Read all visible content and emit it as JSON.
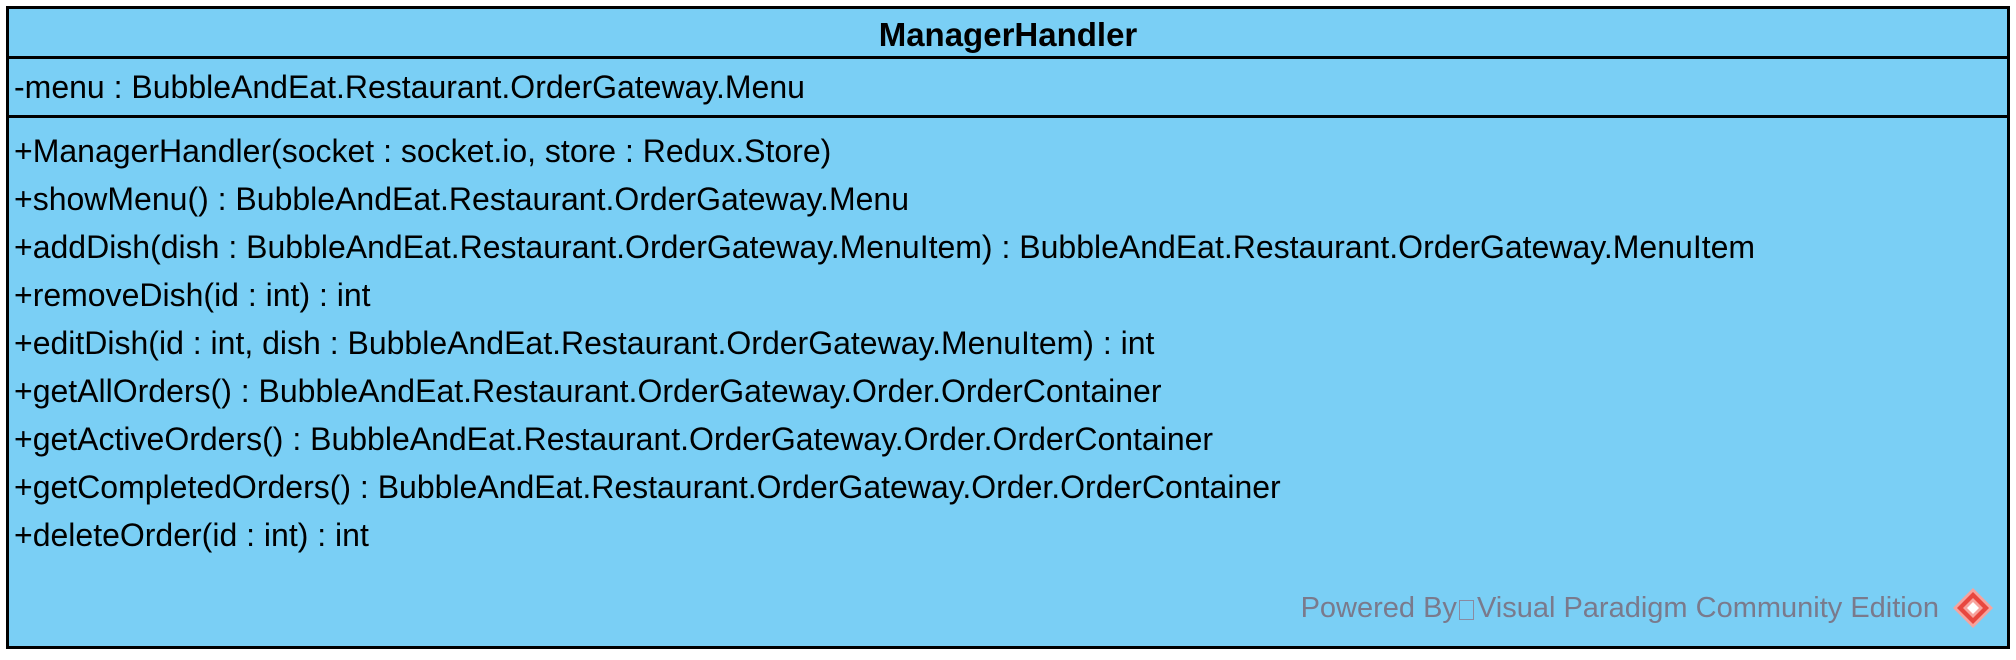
{
  "class": {
    "name": "ManagerHandler",
    "attributes": [
      "-menu : BubbleAndEat.Restaurant.OrderGateway.Menu"
    ],
    "operations": [
      "+ManagerHandler(socket : socket.io, store : Redux.Store)",
      "+showMenu() : BubbleAndEat.Restaurant.OrderGateway.Menu",
      "+addDish(dish : BubbleAndEat.Restaurant.OrderGateway.MenuItem) : BubbleAndEat.Restaurant.OrderGateway.MenuItem",
      "+removeDish(id : int) : int",
      "+editDish(id : int, dish : BubbleAndEat.Restaurant.OrderGateway.MenuItem) : int",
      "+getAllOrders() : BubbleAndEat.Restaurant.OrderGateway.Order.OrderContainer",
      "+getActiveOrders() : BubbleAndEat.Restaurant.OrderGateway.Order.OrderContainer",
      "+getCompletedOrders() : BubbleAndEat.Restaurant.OrderGateway.Order.OrderContainer",
      "+deleteOrder(id : int) : int"
    ]
  },
  "watermark": {
    "prefix": "Powered By",
    "product": "Visual Paradigm Community Edition",
    "logo_icon": "visual-paradigm-logo-icon"
  },
  "colors": {
    "class_fill": "#7acff5",
    "border": "#000000",
    "watermark_text": "#7a7a8c",
    "logo_primary": "#e8473f",
    "logo_secondary": "#f7a39e"
  }
}
